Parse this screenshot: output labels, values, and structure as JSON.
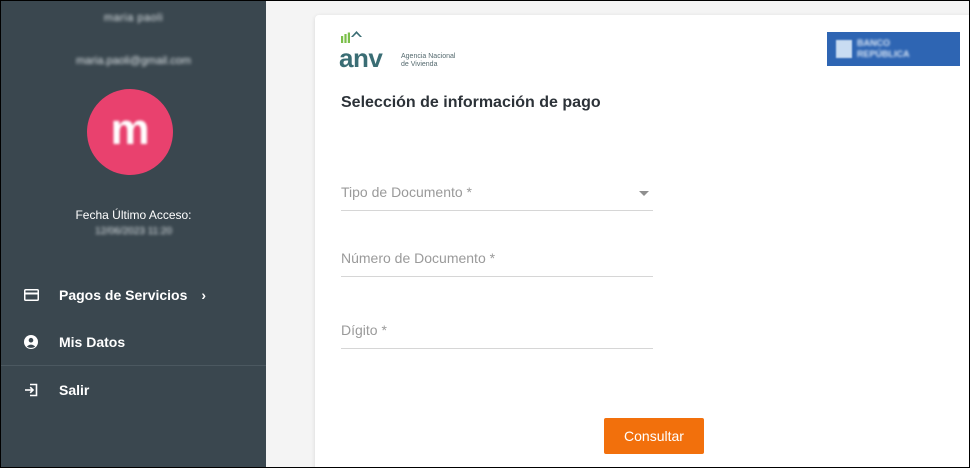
{
  "user": {
    "name": "maria paoli",
    "email": "maria.paoli@gmail.com",
    "avatar_initial": "m",
    "last_access_label": "Fecha Último Acceso:",
    "last_access_value": "12/06/2023 11:20"
  },
  "menu": {
    "items": [
      {
        "label": "Pagos de Servicios",
        "icon": "credit-card-icon",
        "chevron": "›"
      },
      {
        "label": "Mis Datos",
        "icon": "user-circle-icon"
      },
      {
        "label": "Salir",
        "icon": "sign-out-icon"
      }
    ]
  },
  "logos": {
    "anv_word": "anv",
    "anv_sub_line1": "Agencia Nacional",
    "anv_sub_line2": "de Vivienda",
    "bank_line1": "BANCO",
    "bank_line2": "REPÚBLICA"
  },
  "form": {
    "title": "Selección de información de pago",
    "tipo_documento_label": "Tipo de Documento *",
    "numero_documento_label": "Número de Documento *",
    "digito_label": "Dígito *",
    "submit_label": "Consultar"
  },
  "colors": {
    "sidebar_bg": "#3a474f",
    "avatar_bg": "#e9416e",
    "accent_orange": "#f2700c",
    "bank_blue": "#2e65b3"
  }
}
